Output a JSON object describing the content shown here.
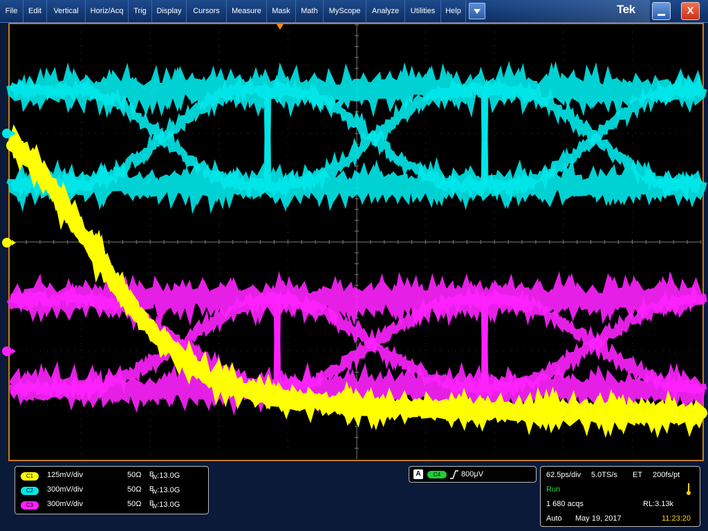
{
  "menu": {
    "items": [
      "File",
      "Edit",
      "Vertical",
      "Horiz/Acq",
      "Trig",
      "Display",
      "Cursors",
      "Measure",
      "Mask",
      "Math",
      "MyScope",
      "Analyze",
      "Utilities",
      "Help"
    ]
  },
  "brand": "Tek",
  "window_controls": {
    "close_glyph": "X"
  },
  "colors": {
    "ch1": "#ffff00",
    "ch2": "#00e8ea",
    "ch3": "#ff22ff",
    "ch4": "#22cc33",
    "graticule_frame": "#c67a1a",
    "trigger_marker": "#ff8c00",
    "status_run": "#22e03a",
    "status_time": "#ffd400"
  },
  "channel_markers": {
    "ch1": "1",
    "ch2": "2",
    "ch3": "3"
  },
  "channels": [
    {
      "badge": "C1",
      "scale": "125mV/div",
      "impedance": "50Ω",
      "bw_b": "B",
      "bw_w": "W",
      "bw_value": ":13.0G"
    },
    {
      "badge": "C2",
      "scale": "300mV/div",
      "impedance": "50Ω",
      "bw_b": "B",
      "bw_w": "W",
      "bw_value": ":13.0G"
    },
    {
      "badge": "C3",
      "scale": "300mV/div",
      "impedance": "50Ω",
      "bw_b": "B",
      "bw_w": "W",
      "bw_value": ":13.0G"
    }
  ],
  "trigger": {
    "label": "A",
    "source": "C4",
    "slope": "rising-edge-icon",
    "level": "800μV"
  },
  "status": {
    "horizontal_scale": "62.5ps/div",
    "sample_rate": "5.0TS/s",
    "mode": "ET",
    "resolution": "200fs/pt",
    "run_state": "Run",
    "acquisitions": "1 680 acqs",
    "record_length": "RL:3.13k",
    "trigger_mode": "Auto",
    "date": "May 19, 2017",
    "time": "11:23:20"
  }
}
